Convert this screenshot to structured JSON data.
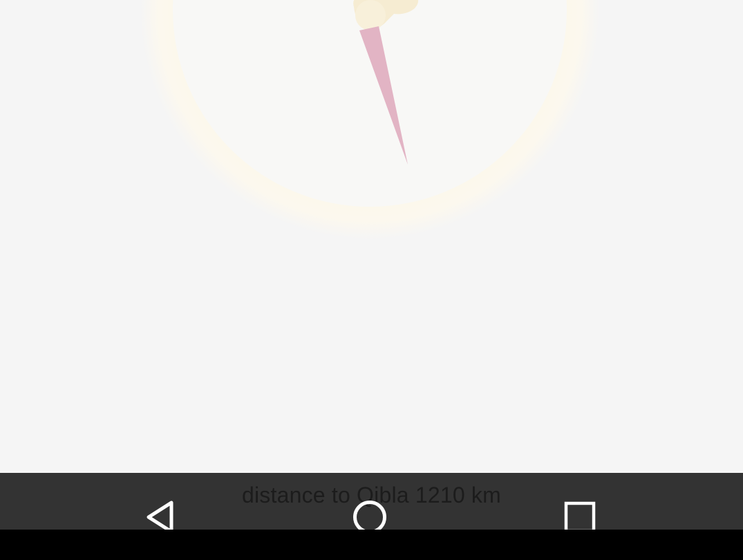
{
  "app": {
    "distance_label": "distance to Qibla 1210 km"
  },
  "compass": {
    "dial_icon": "compass-dial-icon",
    "needle_icon": "qibla-needle-icon",
    "colors": {
      "background": "#f5f5f5",
      "dial_ring": "#fbf6e8",
      "dial_face": "#f8f8f6",
      "needle": "#e2b4c4",
      "needle_base": "#f6ecd2"
    }
  },
  "nav_bar": {
    "back_icon": "back-triangle-icon",
    "home_icon": "home-circle-icon",
    "recents_icon": "recents-square-icon",
    "colors": {
      "bar": "#333333",
      "icon": "#ffffff",
      "bottom": "#000000"
    }
  }
}
